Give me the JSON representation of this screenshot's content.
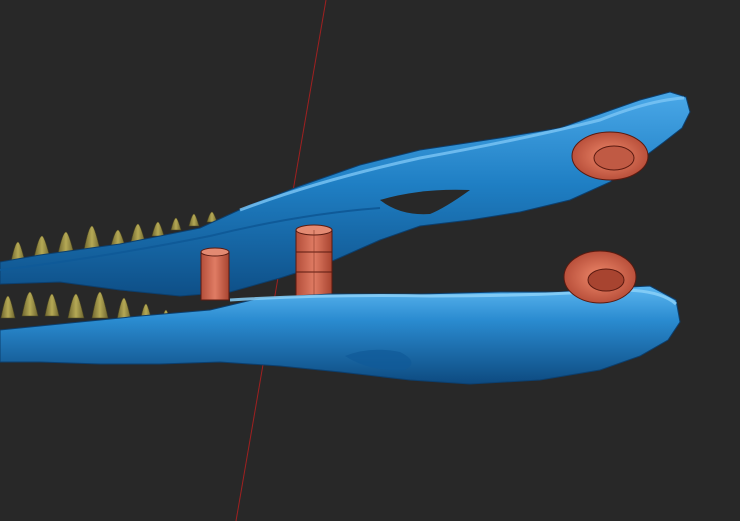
{
  "scene": {
    "background_color": "#282828",
    "model_color": "#1f7fc4",
    "model_highlight_color": "#58b4ee",
    "model_shadow_color": "#0e4f87",
    "teeth_color": "#9a8f42",
    "pin_color": "#d56a54",
    "pin_edge_color": "#5a1a10",
    "axis_line_color": "#a02020",
    "icons": [
      "3d-viewport",
      "jaw-model",
      "teeth",
      "pins",
      "axis-line"
    ]
  }
}
